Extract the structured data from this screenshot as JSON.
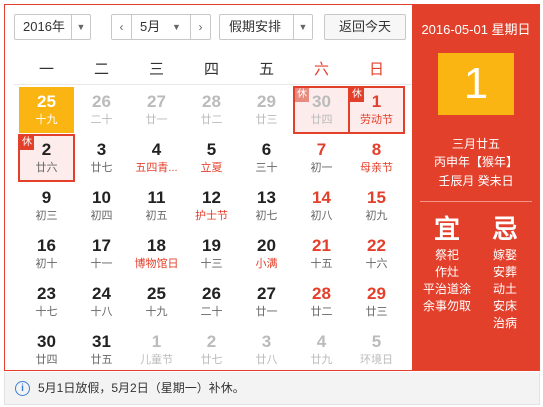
{
  "toolbar": {
    "year": "2016年",
    "month": "5月",
    "holiday": "假期安排",
    "today_button": "返回今天",
    "prev_icon": "‹",
    "next_icon": "›"
  },
  "weekdays": [
    "一",
    "二",
    "三",
    "四",
    "五",
    "六",
    "日"
  ],
  "cells": [
    {
      "day": "25",
      "sub": "十九",
      "classes": "today"
    },
    {
      "day": "26",
      "sub": "二十",
      "classes": "other"
    },
    {
      "day": "27",
      "sub": "廿一",
      "classes": "other"
    },
    {
      "day": "28",
      "sub": "廿二",
      "classes": "other"
    },
    {
      "day": "29",
      "sub": "廿三",
      "classes": "other"
    },
    {
      "day": "30",
      "sub": "廿四",
      "classes": "other weekend rest boxed",
      "tag": "休"
    },
    {
      "day": "1",
      "sub": "劳动节",
      "classes": "weekend fest rest boxed",
      "tag": "休"
    },
    {
      "day": "2",
      "sub": "廿六",
      "classes": "rest boxed",
      "tag": "休"
    },
    {
      "day": "3",
      "sub": "廿七",
      "classes": ""
    },
    {
      "day": "4",
      "sub": "五四青...",
      "classes": "fest"
    },
    {
      "day": "5",
      "sub": "立夏",
      "classes": "fest"
    },
    {
      "day": "6",
      "sub": "三十",
      "classes": ""
    },
    {
      "day": "7",
      "sub": "初一",
      "classes": "weekend"
    },
    {
      "day": "8",
      "sub": "母亲节",
      "classes": "weekend fest"
    },
    {
      "day": "9",
      "sub": "初三",
      "classes": ""
    },
    {
      "day": "10",
      "sub": "初四",
      "classes": ""
    },
    {
      "day": "11",
      "sub": "初五",
      "classes": ""
    },
    {
      "day": "12",
      "sub": "护士节",
      "classes": "fest"
    },
    {
      "day": "13",
      "sub": "初七",
      "classes": ""
    },
    {
      "day": "14",
      "sub": "初八",
      "classes": "weekend"
    },
    {
      "day": "15",
      "sub": "初九",
      "classes": "weekend"
    },
    {
      "day": "16",
      "sub": "初十",
      "classes": ""
    },
    {
      "day": "17",
      "sub": "十一",
      "classes": ""
    },
    {
      "day": "18",
      "sub": "博物馆日",
      "classes": "fest"
    },
    {
      "day": "19",
      "sub": "十三",
      "classes": ""
    },
    {
      "day": "20",
      "sub": "小满",
      "classes": "fest"
    },
    {
      "day": "21",
      "sub": "十五",
      "classes": "weekend"
    },
    {
      "day": "22",
      "sub": "十六",
      "classes": "weekend"
    },
    {
      "day": "23",
      "sub": "十七",
      "classes": ""
    },
    {
      "day": "24",
      "sub": "十八",
      "classes": ""
    },
    {
      "day": "25",
      "sub": "十九",
      "classes": ""
    },
    {
      "day": "26",
      "sub": "二十",
      "classes": ""
    },
    {
      "day": "27",
      "sub": "廿一",
      "classes": ""
    },
    {
      "day": "28",
      "sub": "廿二",
      "classes": "weekend"
    },
    {
      "day": "29",
      "sub": "廿三",
      "classes": "weekend"
    },
    {
      "day": "30",
      "sub": "廿四",
      "classes": ""
    },
    {
      "day": "31",
      "sub": "廿五",
      "classes": ""
    },
    {
      "day": "1",
      "sub": "儿童节",
      "classes": "other"
    },
    {
      "day": "2",
      "sub": "廿七",
      "classes": "other"
    },
    {
      "day": "3",
      "sub": "廿八",
      "classes": "other"
    },
    {
      "day": "4",
      "sub": "廿九",
      "classes": "other"
    },
    {
      "day": "5",
      "sub": "环境日",
      "classes": "other"
    }
  ],
  "panel": {
    "date_line": "2016-05-01 星期日",
    "day": "1",
    "lunar": "三月廿五",
    "ganzhi_year": "丙申年【猴年】",
    "ganzhi_month_day": "壬辰月 癸未日",
    "yi_title": "宜",
    "yi_items": [
      "祭祀",
      "作灶",
      "平治道涂",
      "余事勿取"
    ],
    "ji_title": "忌",
    "ji_items": [
      "嫁娶",
      "安葬",
      "动土",
      "安床",
      "治病"
    ]
  },
  "footer": {
    "note": "5月1日放假，5月2日（星期一）补休。",
    "info_icon": "i"
  },
  "colors": {
    "accent_red": "#e3402c",
    "today_yellow": "#fbb512"
  }
}
